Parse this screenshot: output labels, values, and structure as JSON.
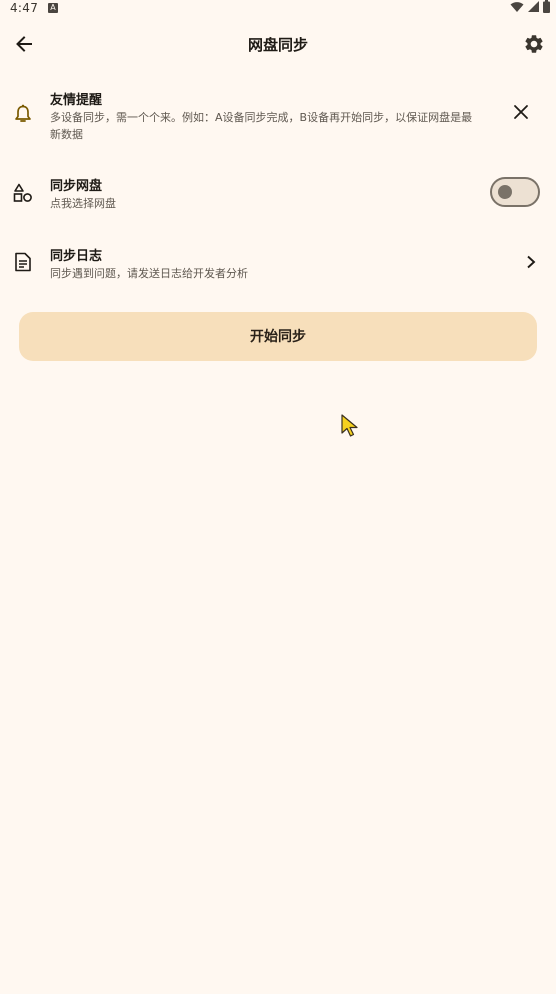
{
  "status_bar": {
    "time": "4:47",
    "notification_glyph": "A",
    "icons": [
      "wifi-icon",
      "signal-icon",
      "battery-icon"
    ]
  },
  "app_bar": {
    "title": "网盘同步",
    "back_icon": "arrow-back-icon",
    "settings_icon": "gear-icon"
  },
  "tip": {
    "icon": "bell-icon",
    "title": "友情提醒",
    "message_line1": "多设备同步，需一个个来。例如：A设备同步完成，B设备再开始同步，以保证网盘是最",
    "message_line2": "新数据",
    "close_icon": "close-icon"
  },
  "sync_drive": {
    "icon": "shapes-icon",
    "title": "同步网盘",
    "subtitle": "点我选择网盘",
    "enabled": false
  },
  "sync_log": {
    "icon": "document-icon",
    "title": "同步日志",
    "subtitle": "同步遇到问题，请发送日志给开发者分析",
    "chevron_icon": "chevron-right-icon"
  },
  "start_button": {
    "label": "开始同步"
  },
  "colors": {
    "background": "#fff8f1",
    "accent_button": "#f7dfbb",
    "bell_icon": "#7a5a00",
    "text_primary": "#1f1b16",
    "text_secondary": "#5f5850"
  }
}
